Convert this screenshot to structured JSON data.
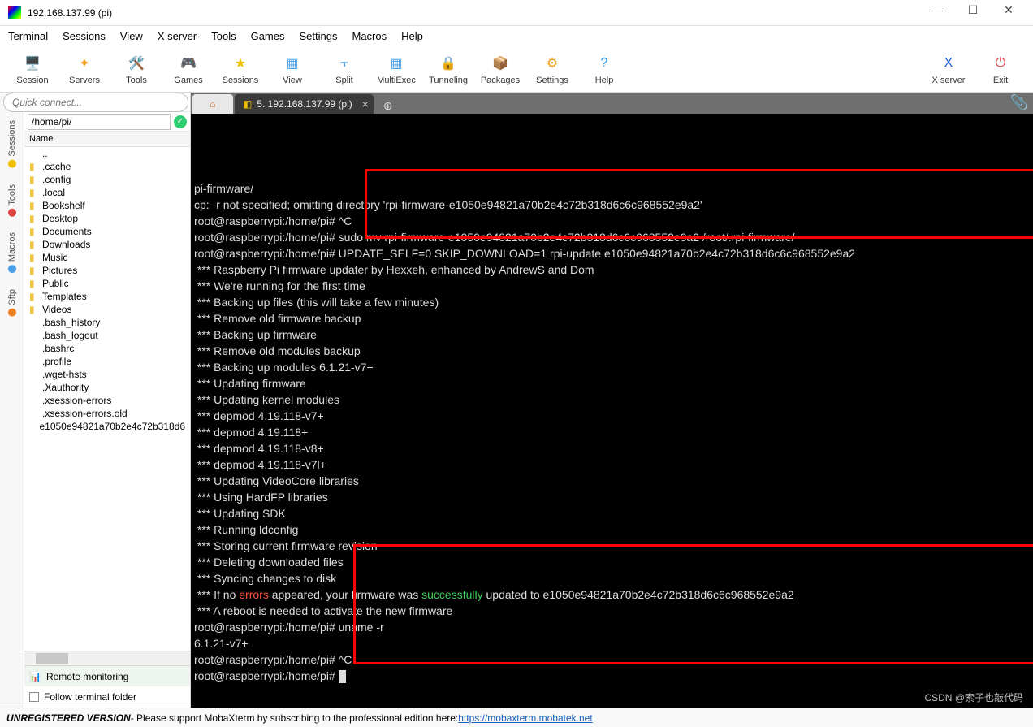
{
  "window": {
    "title": "192.168.137.99 (pi)"
  },
  "win_controls": {
    "min": "—",
    "max": "☐",
    "close": "✕"
  },
  "menu": [
    "Terminal",
    "Sessions",
    "View",
    "X server",
    "Tools",
    "Games",
    "Settings",
    "Macros",
    "Help"
  ],
  "toolbar": [
    {
      "label": "Session",
      "glyph": "🖥️",
      "color": "#e04040"
    },
    {
      "label": "Servers",
      "glyph": "✦",
      "color": "#f0a020"
    },
    {
      "label": "Tools",
      "glyph": "🛠️",
      "color": "#e04040"
    },
    {
      "label": "Games",
      "glyph": "🎮",
      "color": "#808080"
    },
    {
      "label": "Sessions",
      "glyph": "★",
      "color": "#f0c000"
    },
    {
      "label": "View",
      "glyph": "▦",
      "color": "#4aa0e8"
    },
    {
      "label": "Split",
      "glyph": "⫟",
      "color": "#4aa0e8"
    },
    {
      "label": "MultiExec",
      "glyph": "▦",
      "color": "#4aa0e8"
    },
    {
      "label": "Tunneling",
      "glyph": "🔒",
      "color": "#808080"
    },
    {
      "label": "Packages",
      "glyph": "📦",
      "color": "#c08040"
    },
    {
      "label": "Settings",
      "glyph": "⚙",
      "color": "#f0a020"
    },
    {
      "label": "Help",
      "glyph": "?",
      "color": "#2196f3"
    }
  ],
  "toolbar_right": [
    {
      "label": "X server",
      "glyph": "X",
      "color": "#2060e0"
    },
    {
      "label": "Exit",
      "glyph": "⏻",
      "color": "#e04040"
    }
  ],
  "quick_connect": {
    "placeholder": "Quick connect..."
  },
  "left_tabs": [
    {
      "label": "Sessions",
      "dot": "#f0c000"
    },
    {
      "label": "Tools",
      "dot": "#e04040"
    },
    {
      "label": "Macros",
      "dot": "#4aa0e8"
    },
    {
      "label": "Sftp",
      "dot": "#f08020"
    }
  ],
  "path": {
    "value": "/home/pi/"
  },
  "file_header": "Name",
  "files": [
    {
      "name": "..",
      "type": "up"
    },
    {
      "name": ".cache",
      "type": "folder"
    },
    {
      "name": ".config",
      "type": "folder"
    },
    {
      "name": ".local",
      "type": "folder"
    },
    {
      "name": "Bookshelf",
      "type": "folder"
    },
    {
      "name": "Desktop",
      "type": "folder"
    },
    {
      "name": "Documents",
      "type": "folder"
    },
    {
      "name": "Downloads",
      "type": "folder"
    },
    {
      "name": "Music",
      "type": "folder"
    },
    {
      "name": "Pictures",
      "type": "folder"
    },
    {
      "name": "Public",
      "type": "folder"
    },
    {
      "name": "Templates",
      "type": "folder"
    },
    {
      "name": "Videos",
      "type": "folder"
    },
    {
      "name": ".bash_history",
      "type": "file"
    },
    {
      "name": ".bash_logout",
      "type": "file"
    },
    {
      "name": ".bashrc",
      "type": "file"
    },
    {
      "name": ".profile",
      "type": "file"
    },
    {
      "name": ".wget-hsts",
      "type": "file"
    },
    {
      "name": ".Xauthority",
      "type": "file"
    },
    {
      "name": ".xsession-errors",
      "type": "file"
    },
    {
      "name": ".xsession-errors.old",
      "type": "file"
    },
    {
      "name": "e1050e94821a70b2e4c72b318d6",
      "type": "file"
    }
  ],
  "remote_monitoring": "Remote monitoring",
  "follow": "Follow terminal folder",
  "tabs": {
    "active": "5. 192.168.137.99 (pi)"
  },
  "terminal_lines": [
    {
      "segs": [
        {
          "t": "pi-firmware/"
        }
      ]
    },
    {
      "segs": [
        {
          "t": "cp: -r not specified; omitting directory 'rpi-firmware-e1050e94821a70b2e4c72b318d6c6c968552e9a2'"
        }
      ]
    },
    {
      "segs": [
        {
          "t": "root@raspberrypi:/home/pi# ^C"
        }
      ]
    },
    {
      "segs": [
        {
          "t": "root@raspberrypi:/home/pi# sudo mv rpi-firmware-e1050e94821a70b2e4c72b318d6c6c968552e9a2 /root/.rpi-firmware/"
        }
      ]
    },
    {
      "segs": [
        {
          "t": "root@raspberrypi:/home/pi# UPDATE_SELF=0 SKIP_DOWNLOAD=1 rpi-update e1050e94821a70b2e4c72b318d6c6c968552e9a2"
        }
      ]
    },
    {
      "segs": [
        {
          "t": " *** Raspberry Pi firmware updater by Hexxeh, enhanced by AndrewS and Dom"
        }
      ]
    },
    {
      "segs": [
        {
          "t": " *** We're running for the first time"
        }
      ]
    },
    {
      "segs": [
        {
          "t": " *** Backing up files (this will take a few minutes)"
        }
      ]
    },
    {
      "segs": [
        {
          "t": " *** Remove old firmware backup"
        }
      ]
    },
    {
      "segs": [
        {
          "t": " *** Backing up firmware"
        }
      ]
    },
    {
      "segs": [
        {
          "t": " *** Remove old modules backup"
        }
      ]
    },
    {
      "segs": [
        {
          "t": " *** Backing up modules 6.1.21-v7+"
        }
      ]
    },
    {
      "segs": [
        {
          "t": " *** Updating firmware"
        }
      ]
    },
    {
      "segs": [
        {
          "t": " *** Updating kernel modules"
        }
      ]
    },
    {
      "segs": [
        {
          "t": " *** depmod 4.19.118-v7+"
        }
      ]
    },
    {
      "segs": [
        {
          "t": " *** depmod 4.19.118+"
        }
      ]
    },
    {
      "segs": [
        {
          "t": " *** depmod 4.19.118-v8+"
        }
      ]
    },
    {
      "segs": [
        {
          "t": " *** depmod 4.19.118-v7l+"
        }
      ]
    },
    {
      "segs": [
        {
          "t": " *** Updating VideoCore libraries"
        }
      ]
    },
    {
      "segs": [
        {
          "t": " *** Using HardFP libraries"
        }
      ]
    },
    {
      "segs": [
        {
          "t": " *** Updating SDK"
        }
      ]
    },
    {
      "segs": [
        {
          "t": " *** Running ldconfig"
        }
      ]
    },
    {
      "segs": [
        {
          "t": " *** Storing current firmware revision"
        }
      ]
    },
    {
      "segs": [
        {
          "t": " *** Deleting downloaded files"
        }
      ]
    },
    {
      "segs": [
        {
          "t": " *** Syncing changes to disk"
        }
      ]
    },
    {
      "segs": [
        {
          "t": " *** If no "
        },
        {
          "t": "errors",
          "c": "c-red"
        },
        {
          "t": " appeared, your firmware was "
        },
        {
          "t": "successfully",
          "c": "c-green"
        },
        {
          "t": " updated to e1050e94821a70b2e4c72b318d6c6c968552e9a2"
        }
      ]
    },
    {
      "segs": [
        {
          "t": " *** A reboot is needed to activate the new firmware"
        }
      ]
    },
    {
      "segs": [
        {
          "t": "root@raspberrypi:/home/pi# uname -r"
        }
      ]
    },
    {
      "segs": [
        {
          "t": "6.1.21-v7+"
        }
      ]
    },
    {
      "segs": [
        {
          "t": "root@raspberrypi:/home/pi# ^C"
        }
      ]
    },
    {
      "segs": [
        {
          "t": "root@raspberrypi:/home/pi# "
        }
      ],
      "cursor": true
    }
  ],
  "status": {
    "unreg": "UNREGISTERED VERSION",
    "msg": "  -  Please support MobaXterm by subscribing to the professional edition here:  ",
    "link": "https://mobaxterm.mobatek.net"
  },
  "watermark": "CSDN @索子也敲代码"
}
